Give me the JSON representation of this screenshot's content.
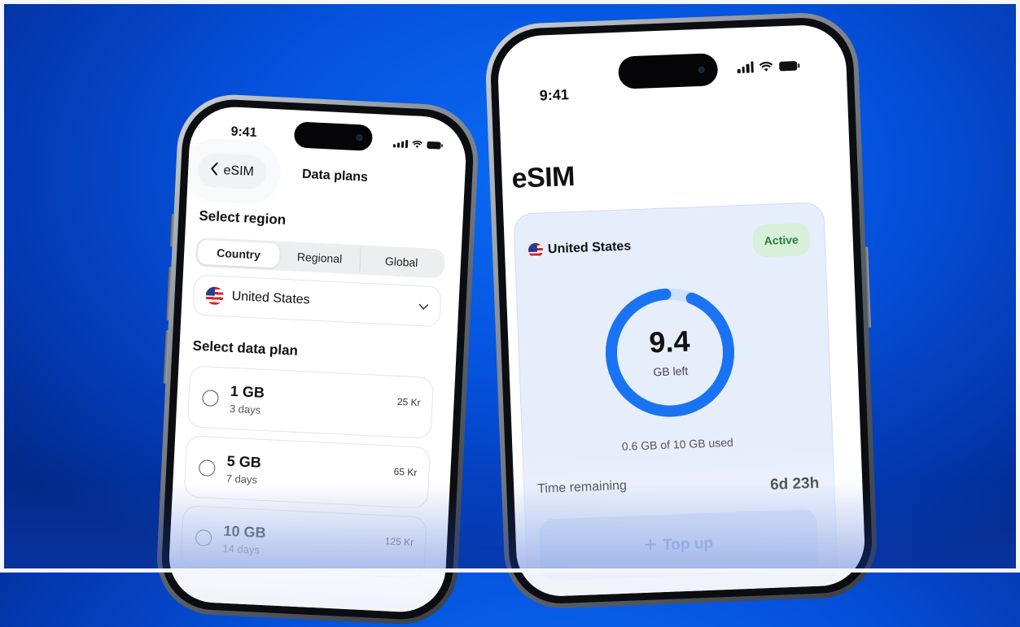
{
  "left_phone": {
    "status": {
      "time": "9:41"
    },
    "nav": {
      "back_label": "eSIM",
      "title": "Data plans"
    },
    "region": {
      "label": "Select region",
      "tabs": [
        "Country",
        "Regional",
        "Global"
      ],
      "selected_tab": "Country",
      "country": "United States"
    },
    "plans": {
      "label": "Select data plan",
      "items": [
        {
          "size": "1 GB",
          "duration": "3 days",
          "price": "25 Kr"
        },
        {
          "size": "5 GB",
          "duration": "7 days",
          "price": "65 Kr"
        },
        {
          "size": "10 GB",
          "duration": "14 days",
          "price": "125 Kr"
        }
      ]
    }
  },
  "right_phone": {
    "status": {
      "time": "9:41"
    },
    "title": "eSIM",
    "card": {
      "country": "United States",
      "status_badge": "Active",
      "remaining_value": "9.4",
      "remaining_unit": "GB left",
      "usage_text": "0.6 GB of 10 GB used",
      "used_fraction": 0.06,
      "time_label": "Time remaining",
      "time_value": "6d 23h",
      "topup_label": "Top up"
    }
  },
  "colors": {
    "accent": "#1a73f2",
    "ring_track": "#cfe0fb",
    "badge_bg": "#d8efd9",
    "badge_text": "#2e7d3a",
    "background": "#0552dd"
  },
  "icons": [
    "back-chevron-icon",
    "chevron-down-icon",
    "signal-icon",
    "wifi-icon",
    "battery-icon",
    "us-flag-icon",
    "plus-icon"
  ]
}
